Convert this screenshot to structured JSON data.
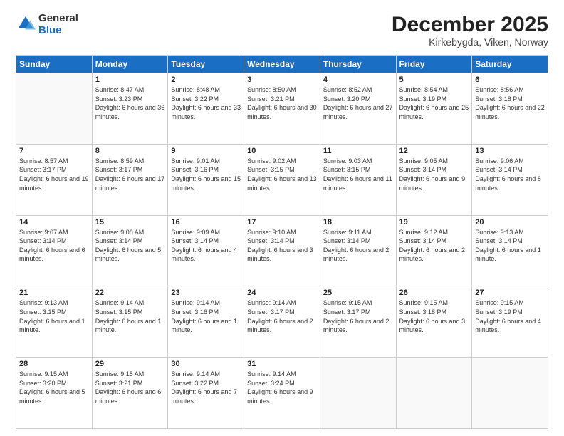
{
  "header": {
    "logo_general": "General",
    "logo_blue": "Blue",
    "month_title": "December 2025",
    "location": "Kirkebygda, Viken, Norway"
  },
  "days_of_week": [
    "Sunday",
    "Monday",
    "Tuesday",
    "Wednesday",
    "Thursday",
    "Friday",
    "Saturday"
  ],
  "weeks": [
    [
      {
        "day": "",
        "sunrise": "",
        "sunset": "",
        "daylight": ""
      },
      {
        "day": "1",
        "sunrise": "Sunrise: 8:47 AM",
        "sunset": "Sunset: 3:23 PM",
        "daylight": "Daylight: 6 hours and 36 minutes."
      },
      {
        "day": "2",
        "sunrise": "Sunrise: 8:48 AM",
        "sunset": "Sunset: 3:22 PM",
        "daylight": "Daylight: 6 hours and 33 minutes."
      },
      {
        "day": "3",
        "sunrise": "Sunrise: 8:50 AM",
        "sunset": "Sunset: 3:21 PM",
        "daylight": "Daylight: 6 hours and 30 minutes."
      },
      {
        "day": "4",
        "sunrise": "Sunrise: 8:52 AM",
        "sunset": "Sunset: 3:20 PM",
        "daylight": "Daylight: 6 hours and 27 minutes."
      },
      {
        "day": "5",
        "sunrise": "Sunrise: 8:54 AM",
        "sunset": "Sunset: 3:19 PM",
        "daylight": "Daylight: 6 hours and 25 minutes."
      },
      {
        "day": "6",
        "sunrise": "Sunrise: 8:56 AM",
        "sunset": "Sunset: 3:18 PM",
        "daylight": "Daylight: 6 hours and 22 minutes."
      }
    ],
    [
      {
        "day": "7",
        "sunrise": "Sunrise: 8:57 AM",
        "sunset": "Sunset: 3:17 PM",
        "daylight": "Daylight: 6 hours and 19 minutes."
      },
      {
        "day": "8",
        "sunrise": "Sunrise: 8:59 AM",
        "sunset": "Sunset: 3:17 PM",
        "daylight": "Daylight: 6 hours and 17 minutes."
      },
      {
        "day": "9",
        "sunrise": "Sunrise: 9:01 AM",
        "sunset": "Sunset: 3:16 PM",
        "daylight": "Daylight: 6 hours and 15 minutes."
      },
      {
        "day": "10",
        "sunrise": "Sunrise: 9:02 AM",
        "sunset": "Sunset: 3:15 PM",
        "daylight": "Daylight: 6 hours and 13 minutes."
      },
      {
        "day": "11",
        "sunrise": "Sunrise: 9:03 AM",
        "sunset": "Sunset: 3:15 PM",
        "daylight": "Daylight: 6 hours and 11 minutes."
      },
      {
        "day": "12",
        "sunrise": "Sunrise: 9:05 AM",
        "sunset": "Sunset: 3:14 PM",
        "daylight": "Daylight: 6 hours and 9 minutes."
      },
      {
        "day": "13",
        "sunrise": "Sunrise: 9:06 AM",
        "sunset": "Sunset: 3:14 PM",
        "daylight": "Daylight: 6 hours and 8 minutes."
      }
    ],
    [
      {
        "day": "14",
        "sunrise": "Sunrise: 9:07 AM",
        "sunset": "Sunset: 3:14 PM",
        "daylight": "Daylight: 6 hours and 6 minutes."
      },
      {
        "day": "15",
        "sunrise": "Sunrise: 9:08 AM",
        "sunset": "Sunset: 3:14 PM",
        "daylight": "Daylight: 6 hours and 5 minutes."
      },
      {
        "day": "16",
        "sunrise": "Sunrise: 9:09 AM",
        "sunset": "Sunset: 3:14 PM",
        "daylight": "Daylight: 6 hours and 4 minutes."
      },
      {
        "day": "17",
        "sunrise": "Sunrise: 9:10 AM",
        "sunset": "Sunset: 3:14 PM",
        "daylight": "Daylight: 6 hours and 3 minutes."
      },
      {
        "day": "18",
        "sunrise": "Sunrise: 9:11 AM",
        "sunset": "Sunset: 3:14 PM",
        "daylight": "Daylight: 6 hours and 2 minutes."
      },
      {
        "day": "19",
        "sunrise": "Sunrise: 9:12 AM",
        "sunset": "Sunset: 3:14 PM",
        "daylight": "Daylight: 6 hours and 2 minutes."
      },
      {
        "day": "20",
        "sunrise": "Sunrise: 9:13 AM",
        "sunset": "Sunset: 3:14 PM",
        "daylight": "Daylight: 6 hours and 1 minute."
      }
    ],
    [
      {
        "day": "21",
        "sunrise": "Sunrise: 9:13 AM",
        "sunset": "Sunset: 3:15 PM",
        "daylight": "Daylight: 6 hours and 1 minute."
      },
      {
        "day": "22",
        "sunrise": "Sunrise: 9:14 AM",
        "sunset": "Sunset: 3:15 PM",
        "daylight": "Daylight: 6 hours and 1 minute."
      },
      {
        "day": "23",
        "sunrise": "Sunrise: 9:14 AM",
        "sunset": "Sunset: 3:16 PM",
        "daylight": "Daylight: 6 hours and 1 minute."
      },
      {
        "day": "24",
        "sunrise": "Sunrise: 9:14 AM",
        "sunset": "Sunset: 3:17 PM",
        "daylight": "Daylight: 6 hours and 2 minutes."
      },
      {
        "day": "25",
        "sunrise": "Sunrise: 9:15 AM",
        "sunset": "Sunset: 3:17 PM",
        "daylight": "Daylight: 6 hours and 2 minutes."
      },
      {
        "day": "26",
        "sunrise": "Sunrise: 9:15 AM",
        "sunset": "Sunset: 3:18 PM",
        "daylight": "Daylight: 6 hours and 3 minutes."
      },
      {
        "day": "27",
        "sunrise": "Sunrise: 9:15 AM",
        "sunset": "Sunset: 3:19 PM",
        "daylight": "Daylight: 6 hours and 4 minutes."
      }
    ],
    [
      {
        "day": "28",
        "sunrise": "Sunrise: 9:15 AM",
        "sunset": "Sunset: 3:20 PM",
        "daylight": "Daylight: 6 hours and 5 minutes."
      },
      {
        "day": "29",
        "sunrise": "Sunrise: 9:15 AM",
        "sunset": "Sunset: 3:21 PM",
        "daylight": "Daylight: 6 hours and 6 minutes."
      },
      {
        "day": "30",
        "sunrise": "Sunrise: 9:14 AM",
        "sunset": "Sunset: 3:22 PM",
        "daylight": "Daylight: 6 hours and 7 minutes."
      },
      {
        "day": "31",
        "sunrise": "Sunrise: 9:14 AM",
        "sunset": "Sunset: 3:24 PM",
        "daylight": "Daylight: 6 hours and 9 minutes."
      },
      {
        "day": "",
        "sunrise": "",
        "sunset": "",
        "daylight": ""
      },
      {
        "day": "",
        "sunrise": "",
        "sunset": "",
        "daylight": ""
      },
      {
        "day": "",
        "sunrise": "",
        "sunset": "",
        "daylight": ""
      }
    ]
  ]
}
